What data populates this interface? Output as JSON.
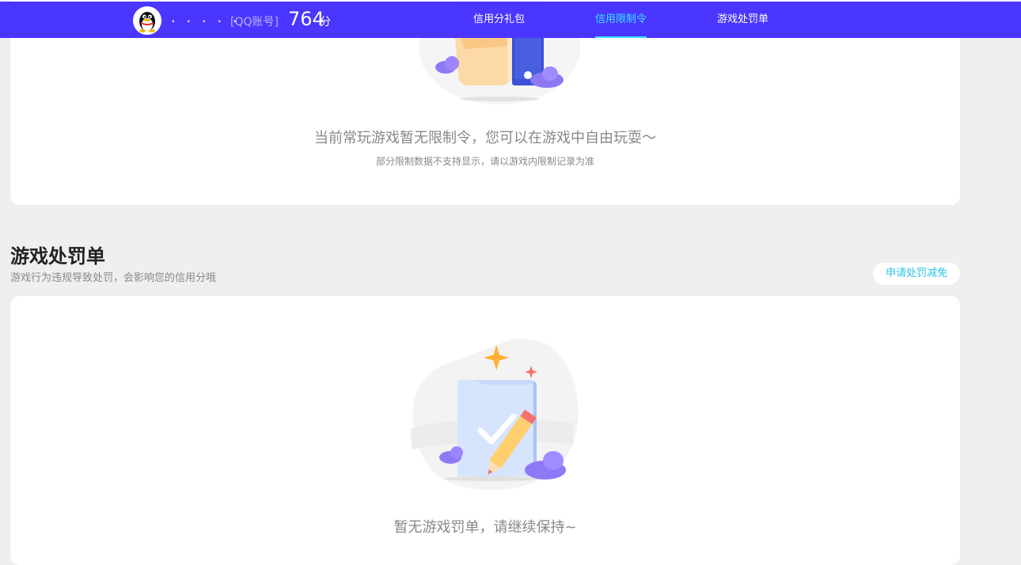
{
  "header": {
    "nickname": ". . . . .",
    "account_label": "[QQ账号]",
    "score": "764",
    "score_unit": "分",
    "nav": [
      {
        "label": "信用分礼包",
        "active": false
      },
      {
        "label": "信用限制令",
        "active": true
      },
      {
        "label": "游戏处罚单",
        "active": false
      }
    ],
    "colors": {
      "bar": "#4b36ff",
      "active": "#39e4ff"
    }
  },
  "restriction": {
    "message": "当前常玩游戏暂无限制令，您可以在游戏中自由玩耍～",
    "note": "部分限制数据不支持显示，请以游戏内限制记录为准",
    "illustration": "hand-phone-illustration"
  },
  "penalty": {
    "title": "游戏处罚单",
    "subtitle": "游戏行为违规导致处罚，会影响您的信用分哦",
    "apply_button": "申请处罚减免",
    "message": "暂无游戏罚单，请继续保持~",
    "illustration": "checklist-pencil-illustration"
  }
}
